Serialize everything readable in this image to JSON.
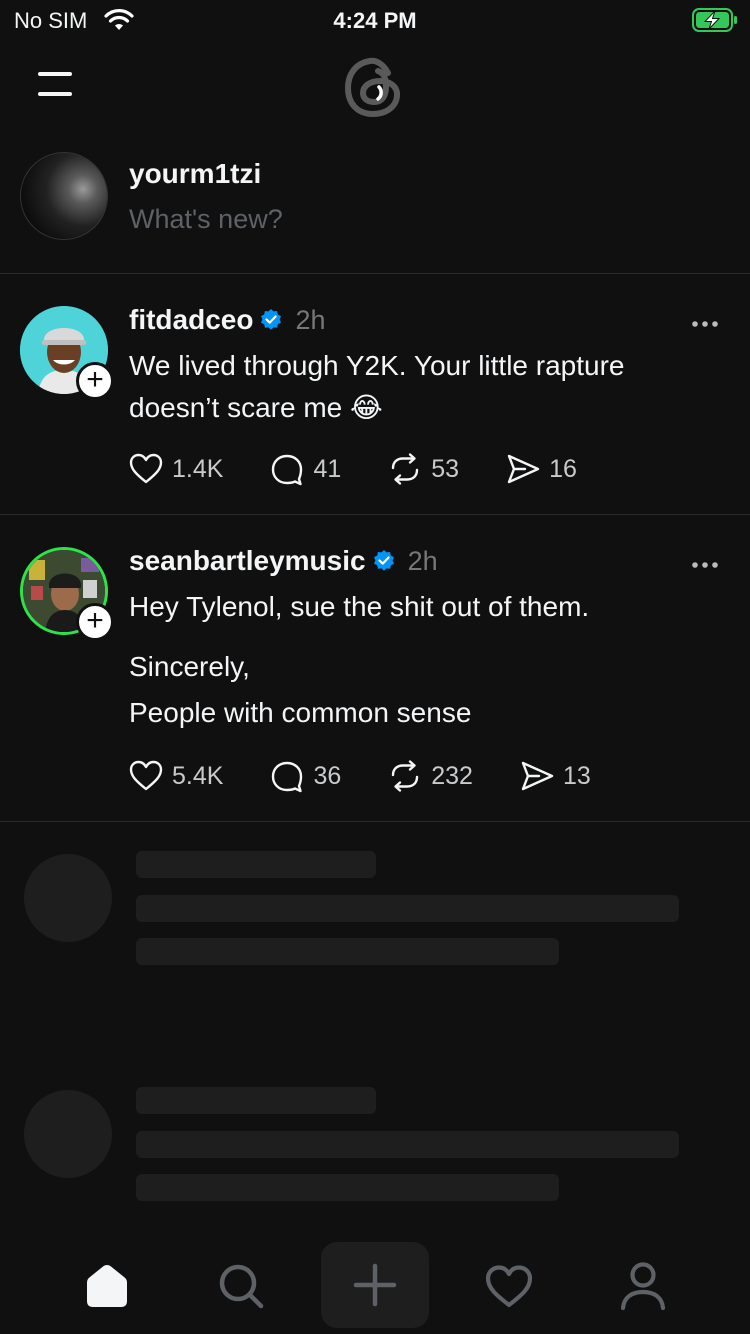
{
  "status_bar": {
    "carrier": "No SIM",
    "time": "4:24 PM",
    "icons": [
      "wifi-icon",
      "battery-charging-icon"
    ]
  },
  "composer": {
    "username": "yourm1tzi",
    "placeholder": "What's new?"
  },
  "posts": [
    {
      "username": "fitdadceo",
      "verified": true,
      "time": "2h",
      "text_lines": [
        "We lived through Y2K. Your little rapture",
        "doesn’t scare me 😂"
      ],
      "likes": "1.4K",
      "replies": "41",
      "reposts": "53",
      "shares": "16"
    },
    {
      "username": "seanbartleymusic",
      "verified": true,
      "time": "2h",
      "text_lines": [
        "Hey Tylenol, sue the shit out of them.",
        "Sincerely,",
        "People with common sense"
      ],
      "likes": "5.4K",
      "replies": "36",
      "reposts": "232",
      "shares": "13"
    }
  ],
  "tab_bar": {
    "tabs": [
      "home-icon",
      "search-icon",
      "plus-icon",
      "heart-icon",
      "profile-icon"
    ],
    "active": "home-icon"
  },
  "colors": {
    "background": "#101010",
    "text": "#f3f5f7",
    "muted": "#777777",
    "verified": "#0095f6",
    "battery": "#34c759"
  }
}
